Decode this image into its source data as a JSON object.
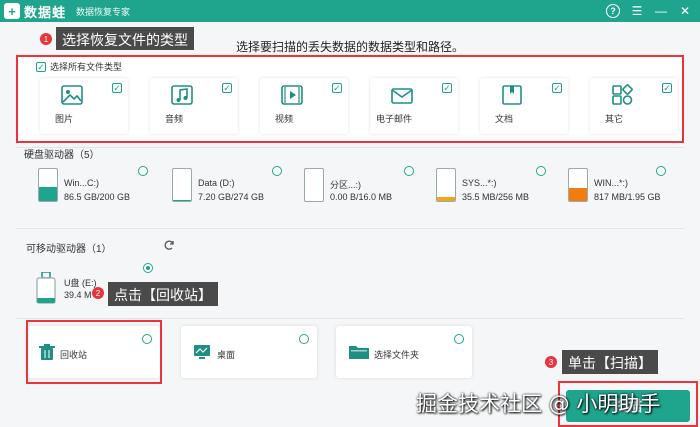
{
  "app": {
    "logo_glyph": "+",
    "name": "数据蛙",
    "slogan": "数据恢复专家"
  },
  "window_controls": {
    "help": "?",
    "menu": "☰",
    "minimize": "—",
    "close": "✕"
  },
  "instruction": "选择要扫描的丢失数据的数据类型和路径。",
  "file_types": {
    "select_all_label": "选择所有文件类型",
    "select_all_checked": true,
    "items": [
      {
        "label": "图片",
        "icon": "image-icon",
        "checked": true
      },
      {
        "label": "音频",
        "icon": "music-icon",
        "checked": true
      },
      {
        "label": "视频",
        "icon": "video-icon",
        "checked": true
      },
      {
        "label": "电子邮件",
        "icon": "email-icon",
        "checked": true
      },
      {
        "label": "文档",
        "icon": "document-icon",
        "checked": true
      },
      {
        "label": "其它",
        "icon": "other-icon",
        "checked": true
      }
    ]
  },
  "hard_drives": {
    "title": "硬盘驱动器（5）",
    "items": [
      {
        "name": "Win...C:)",
        "size": "86.5 GB/200 GB",
        "fill": 0.43,
        "color": "#1fa58d"
      },
      {
        "name": "Data (D:)",
        "size": "7.20 GB/274 GB",
        "fill": 0.03,
        "color": "#1fa58d"
      },
      {
        "name": "分区...:)",
        "size": "0.00  B/16.0 MB",
        "fill": 0.0,
        "color": "#1fa58d"
      },
      {
        "name": "SYS...*:)",
        "size": "35.5 MB/256 MB",
        "fill": 0.14,
        "color": "#f2a516"
      },
      {
        "name": "WIN...*:)",
        "size": "817 MB/1.95 GB",
        "fill": 0.41,
        "color": "#f07c12"
      }
    ]
  },
  "removable": {
    "title": "可移动驱动器（1）",
    "refresh_icon": "refresh-icon",
    "item": {
      "name": "U盘 (E:)",
      "size": "39.4 M",
      "selected": true
    }
  },
  "locations": [
    {
      "label": "回收站",
      "icon": "trash-icon"
    },
    {
      "label": "桌面",
      "icon": "desktop-icon"
    },
    {
      "label": "选择文件夹",
      "icon": "folder-icon"
    }
  ],
  "annotations": {
    "step1": {
      "num": "1",
      "text": "选择恢复文件的类型"
    },
    "step2": {
      "num": "2",
      "text": "点击【回收站】"
    },
    "step3": {
      "num": "3",
      "text": "单击【扫描】"
    }
  },
  "scan_button": "扫描",
  "watermark": "掘金技术社区 @ 小明助手",
  "colors": {
    "brand": "#1fa58d",
    "annotation": "#e8343a"
  }
}
